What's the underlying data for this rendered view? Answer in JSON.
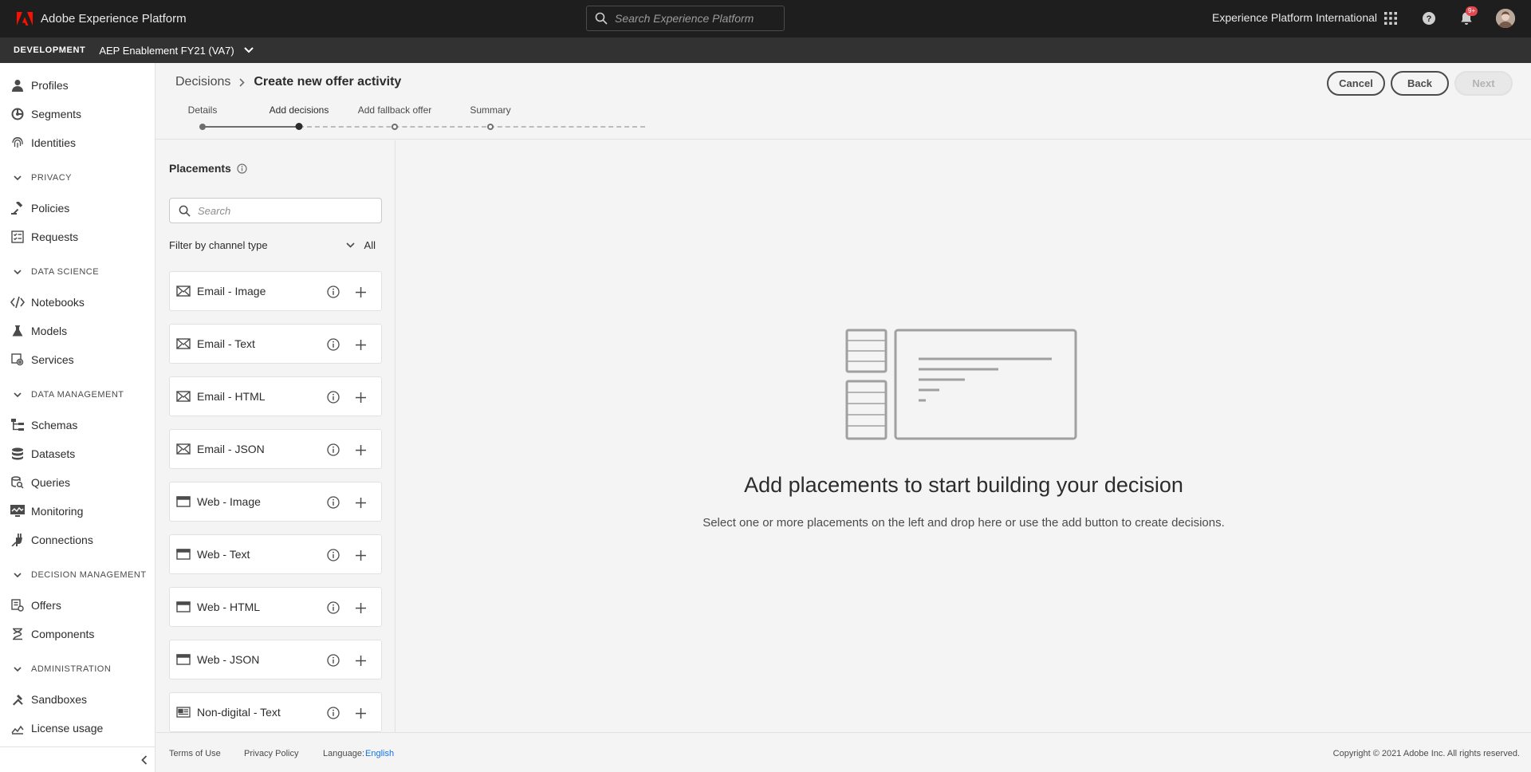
{
  "shell": {
    "app_name": "Adobe Experience Platform",
    "search_placeholder": "Search Experience Platform",
    "org_name": "Experience Platform International",
    "notification_badge": "9+"
  },
  "sandbox": {
    "environment": "DEVELOPMENT",
    "name": "AEP Enablement FY21 (VA7)"
  },
  "nav": {
    "profiles": "Profiles",
    "segments": "Segments",
    "identities": "Identities",
    "privacy": "PRIVACY",
    "policies": "Policies",
    "requests": "Requests",
    "data_science": "DATA SCIENCE",
    "notebooks": "Notebooks",
    "models": "Models",
    "services": "Services",
    "data_management": "DATA MANAGEMENT",
    "schemas": "Schemas",
    "datasets": "Datasets",
    "queries": "Queries",
    "monitoring": "Monitoring",
    "connections": "Connections",
    "decision_management": "DECISION MANAGEMENT",
    "offers": "Offers",
    "components": "Components",
    "administration": "ADMINISTRATION",
    "sandboxes": "Sandboxes",
    "license_usage": "License usage"
  },
  "header": {
    "breadcrumb_parent": "Decisions",
    "breadcrumb_current": "Create new offer activity",
    "cancel": "Cancel",
    "back": "Back",
    "next": "Next"
  },
  "steps": [
    {
      "label": "Details",
      "state": "done"
    },
    {
      "label": "Add decisions",
      "state": "current"
    },
    {
      "label": "Add fallback offer",
      "state": "todo"
    },
    {
      "label": "Summary",
      "state": "todo"
    }
  ],
  "placements": {
    "title": "Placements",
    "search_placeholder": "Search",
    "filter_label": "Filter by channel type",
    "filter_value": "All",
    "items": [
      {
        "label": "Email - Image",
        "icon": "email"
      },
      {
        "label": "Email - Text",
        "icon": "email"
      },
      {
        "label": "Email - HTML",
        "icon": "email"
      },
      {
        "label": "Email - JSON",
        "icon": "email"
      },
      {
        "label": "Web - Image",
        "icon": "web"
      },
      {
        "label": "Web - Text",
        "icon": "web"
      },
      {
        "label": "Web - HTML",
        "icon": "web"
      },
      {
        "label": "Web - JSON",
        "icon": "web"
      },
      {
        "label": "Non-digital - Text",
        "icon": "nondigital"
      }
    ]
  },
  "empty_state": {
    "title": "Add placements to start building your decision",
    "description": "Select one or more placements on the left and drop here or use the add button to create decisions."
  },
  "footer": {
    "terms": "Terms of Use",
    "privacy": "Privacy Policy",
    "language_label": "Language:",
    "language_value": "English",
    "copyright": "Copyright ©  2021 Adobe Inc.  All rights reserved."
  },
  "colors": {
    "shell_bg": "#1e1e1e",
    "sandbar_bg": "#323232",
    "accent_blue": "#1473e6",
    "badge_red": "#e34850",
    "adobe_red": "#fa0f00"
  }
}
